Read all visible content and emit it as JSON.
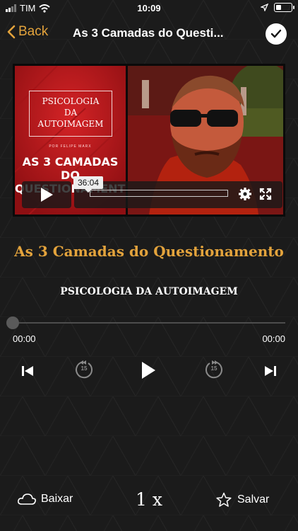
{
  "status_bar": {
    "carrier": "TIM",
    "time": "10:09"
  },
  "nav": {
    "back_label": "Back",
    "title": "As 3 Camadas do Questi..."
  },
  "video": {
    "cover_box": [
      "PSICOLOGIA",
      "DA",
      "AUTOIMAGEM"
    ],
    "cover_byline": "POR FELIPE MARX",
    "cover_title": [
      "AS 3 CAMADAS",
      "DO QUESTIONAMENTO"
    ],
    "duration_tooltip": "36:04"
  },
  "lesson": {
    "title": "As 3 Camadas do Questionamento",
    "course": "PSICOLOGIA DA AUTOIMAGEM"
  },
  "player": {
    "elapsed": "00:00",
    "remaining": "00:00",
    "progress_fraction": 0,
    "skip_back_seconds": "15",
    "skip_forward_seconds": "15",
    "speed": "1 x"
  },
  "actions": {
    "download_label": "Baixar",
    "save_label": "Salvar"
  },
  "colors": {
    "accent": "#e3a33c",
    "background": "#1b1b1b",
    "cover_red": "#c21a1d"
  }
}
